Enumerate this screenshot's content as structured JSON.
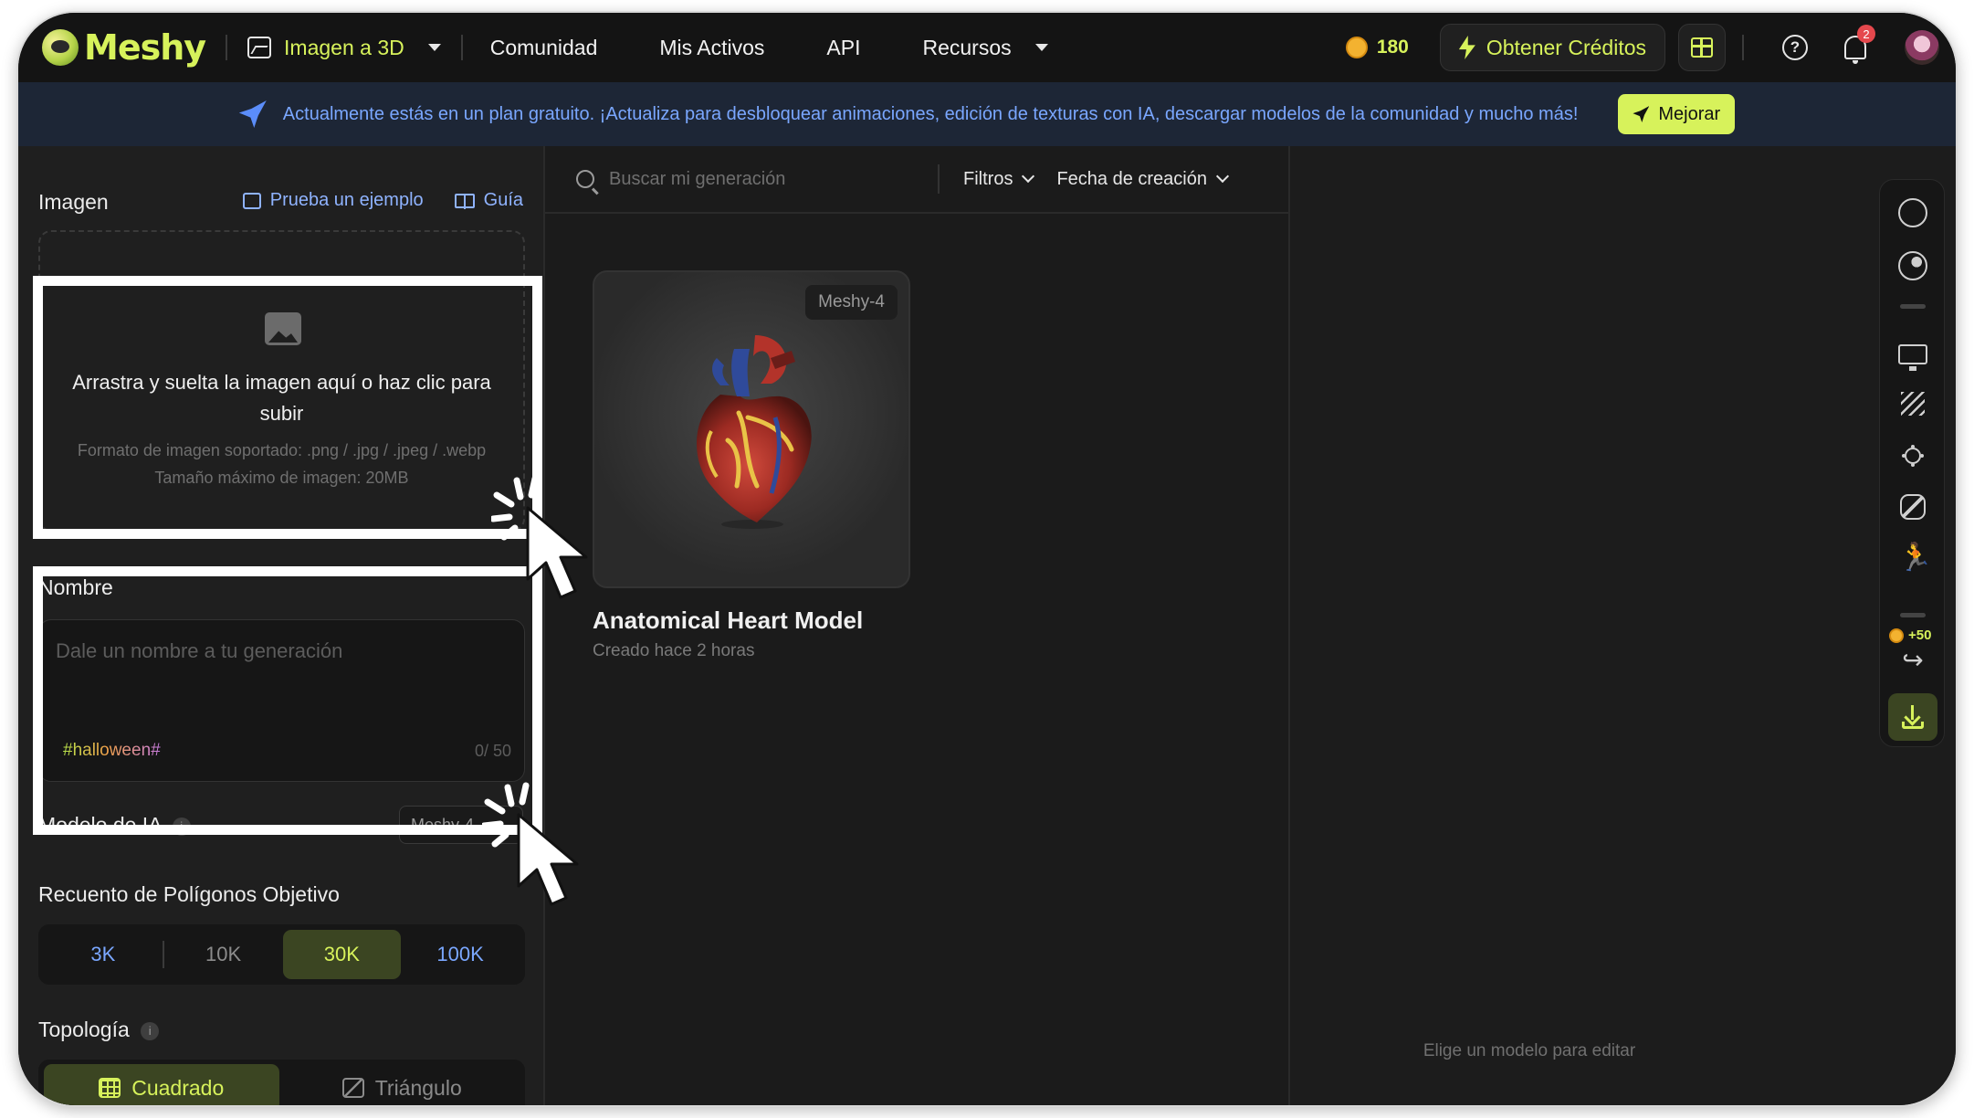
{
  "app": {
    "logo_text": "Meshy",
    "product_menu": "Imagen a 3D",
    "nav": [
      "Comunidad",
      "Mis Activos",
      "API",
      "Recursos"
    ],
    "credits": "180",
    "get_credits": "Obtener Créditos",
    "notifications_count": "2"
  },
  "banner": {
    "text": "Actualmente estás en un plan gratuito. ¡Actualiza para desbloquear animaciones, edición de texturas con IA, descargar modelos de la comunidad y mucho más!",
    "button": "Mejorar"
  },
  "left": {
    "image_title": "Imagen",
    "try_example": "Prueba un ejemplo",
    "guide": "Guía",
    "upload_main": "Arrastra y suelta la imagen aquí o haz clic para subir",
    "upload_formats": "Formato de imagen soportado: .png / .jpg / .jpeg / .webp",
    "upload_maxsize": "Tamaño máximo de imagen: 20MB",
    "name_label": "Nombre",
    "name_placeholder": "Dale un nombre a tu generación",
    "name_tag": "#halloween#",
    "name_counter": "0/ 50",
    "model_label": "Modelo de IA",
    "model_value": "Meshy-4",
    "polycount_label": "Recuento de Polígonos Objetivo",
    "polycount_options": [
      "3K",
      "10K",
      "30K",
      "100K"
    ],
    "polycount_selected": "30K",
    "topology_label": "Topología",
    "topology_options": [
      "Cuadrado",
      "Triángulo"
    ],
    "topology_selected": "Cuadrado"
  },
  "middle": {
    "search_placeholder": "Buscar mi generación",
    "filters": "Filtros",
    "sort": "Fecha de creación",
    "card": {
      "badge": "Meshy-4",
      "title": "Anatomical Heart Model",
      "subtitle": "Creado hace 2 horas"
    }
  },
  "right": {
    "empty_text": "Elige un modelo para editar",
    "reward": "+50"
  },
  "colors": {
    "accent": "#d7f25b",
    "link": "#8fb3ff",
    "banner_bg": "#1d2636",
    "panel_bg": "#1f1f1f"
  },
  "icons": [
    "search-icon",
    "gift-icon",
    "help-icon",
    "bell-icon",
    "rocket-icon",
    "image-icon",
    "book-icon",
    "download-icon",
    "share-icon",
    "sun-icon",
    "monitor-icon",
    "run-icon"
  ]
}
